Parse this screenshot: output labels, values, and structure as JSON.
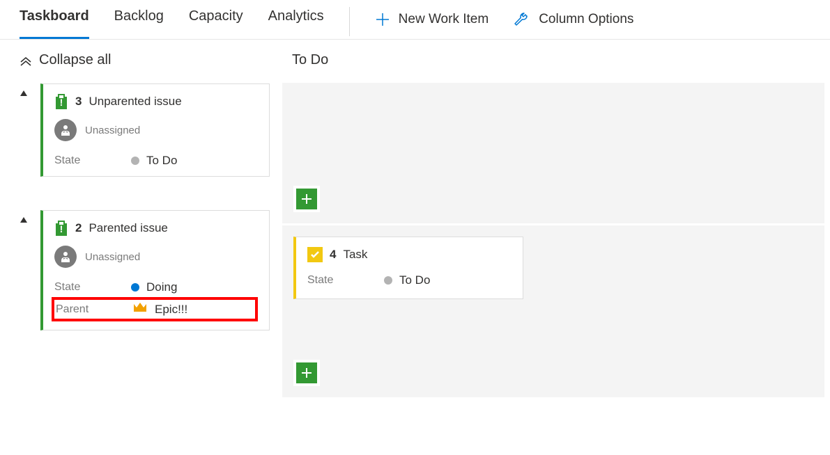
{
  "tabs": {
    "taskboard": "Taskboard",
    "backlog": "Backlog",
    "capacity": "Capacity",
    "analytics": "Analytics"
  },
  "actions": {
    "new_work_item": "New Work Item",
    "column_options": "Column Options"
  },
  "collapse_all": "Collapse all",
  "column_header": "To Do",
  "rows": [
    {
      "id": "3",
      "title": "Unparented issue",
      "assignee": "Unassigned",
      "state_label": "State",
      "state_value": "To Do",
      "state_color": "grey"
    },
    {
      "id": "2",
      "title": "Parented issue",
      "assignee": "Unassigned",
      "state_label": "State",
      "state_value": "Doing",
      "state_color": "blue",
      "parent_label": "Parent",
      "parent_value": "Epic!!!"
    }
  ],
  "task_card": {
    "id": "4",
    "title": "Task",
    "state_label": "State",
    "state_value": "To Do"
  }
}
